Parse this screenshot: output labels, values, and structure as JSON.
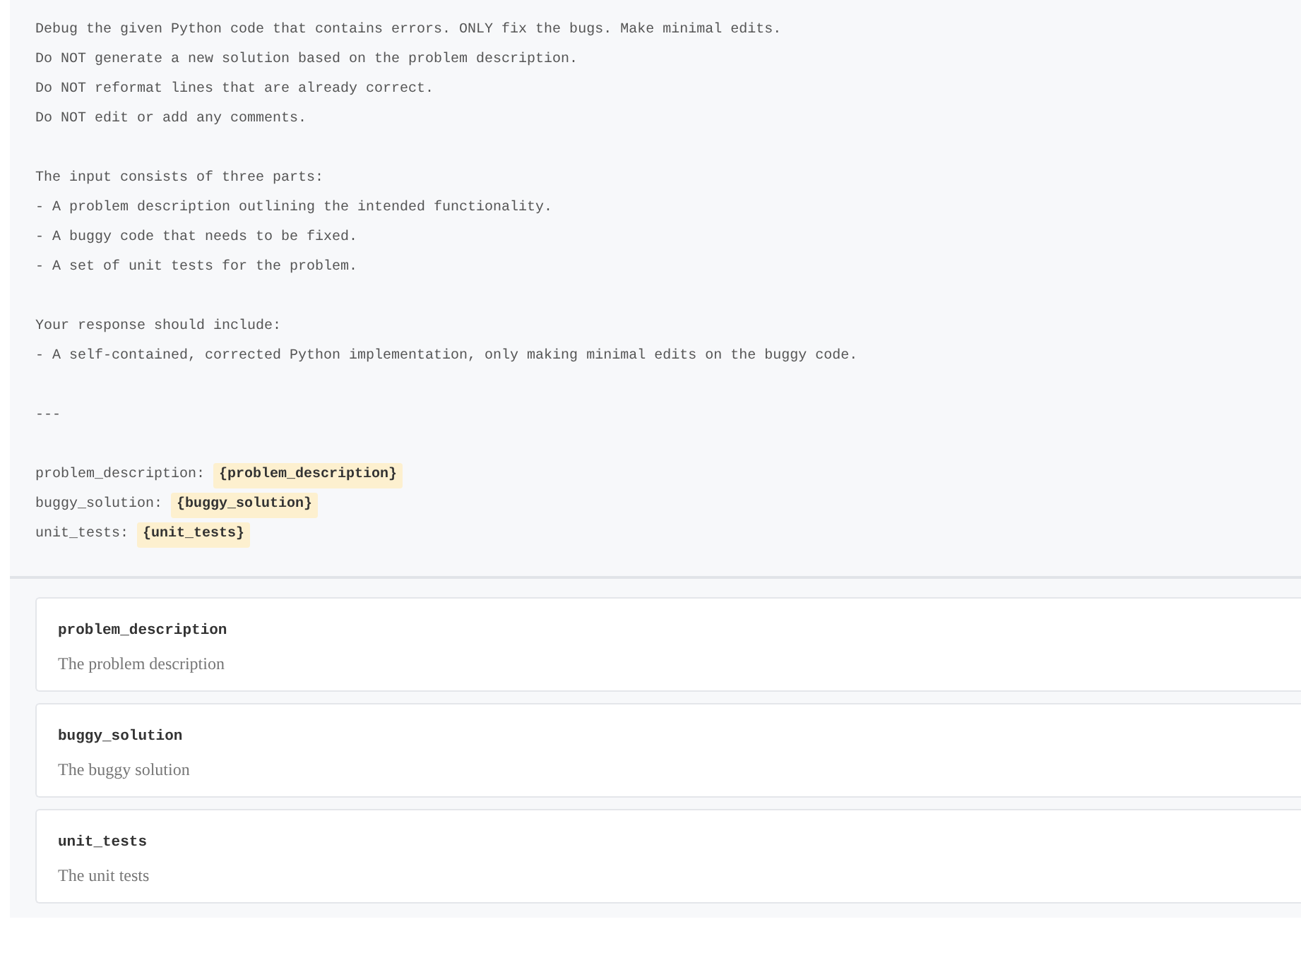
{
  "prompt": {
    "blocks": [
      [
        {
          "kind": "text",
          "text": "Debug the given Python code that contains errors. ONLY fix the bugs. Make minimal edits."
        },
        {
          "kind": "text",
          "text": "Do NOT generate a new solution based on the problem description."
        },
        {
          "kind": "text",
          "text": "Do NOT reformat lines that are already correct."
        },
        {
          "kind": "text",
          "text": "Do NOT edit or add any comments."
        }
      ],
      [
        {
          "kind": "text",
          "text": "The input consists of three parts:"
        },
        {
          "kind": "text",
          "text": "- A problem description outlining the intended functionality."
        },
        {
          "kind": "text",
          "text": "- A buggy code that needs to be fixed."
        },
        {
          "kind": "text",
          "text": "- A set of unit tests for the problem."
        }
      ],
      [
        {
          "kind": "text",
          "text": "Your response should include:"
        },
        {
          "kind": "text",
          "text": "- A self-contained, corrected Python implementation, only making minimal edits on the buggy code."
        }
      ],
      [
        {
          "kind": "text",
          "text": "---"
        }
      ],
      [
        {
          "kind": "variable",
          "label": "problem_description:",
          "variable": "{problem_description}"
        },
        {
          "kind": "variable",
          "label": "buggy_solution:",
          "variable": "{buggy_solution}"
        },
        {
          "kind": "variable",
          "label": "unit_tests:",
          "variable": "{unit_tests}"
        }
      ]
    ]
  },
  "variables": [
    {
      "name": "problem_description",
      "description": "The problem description"
    },
    {
      "name": "buggy_solution",
      "description": "The buggy solution"
    },
    {
      "name": "unit_tests",
      "description": "The unit tests"
    }
  ]
}
